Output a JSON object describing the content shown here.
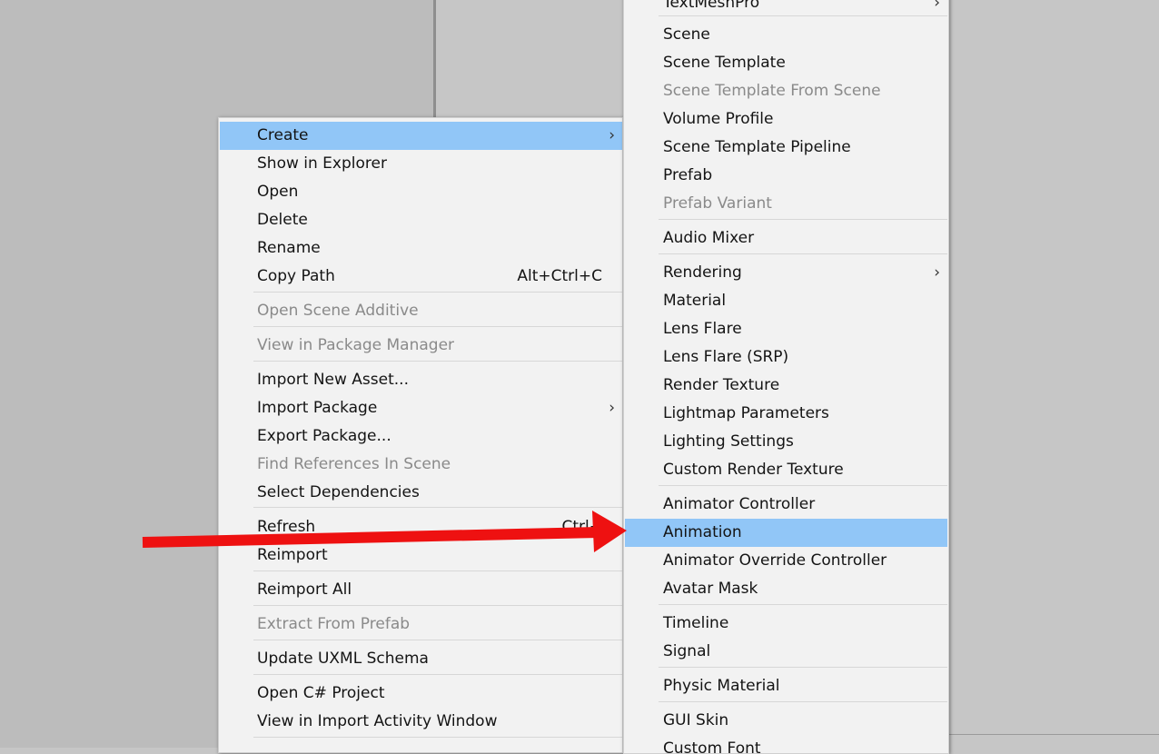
{
  "context_menu": {
    "items": [
      {
        "label": "Create",
        "shortcut": "",
        "submenu": true,
        "disabled": false,
        "highlighted": true
      },
      {
        "label": "Show in Explorer",
        "shortcut": "",
        "submenu": false,
        "disabled": false,
        "highlighted": false
      },
      {
        "label": "Open",
        "shortcut": "",
        "submenu": false,
        "disabled": false,
        "highlighted": false
      },
      {
        "label": "Delete",
        "shortcut": "",
        "submenu": false,
        "disabled": false,
        "highlighted": false
      },
      {
        "label": "Rename",
        "shortcut": "",
        "submenu": false,
        "disabled": false,
        "highlighted": false
      },
      {
        "label": "Copy Path",
        "shortcut": "Alt+Ctrl+C",
        "submenu": false,
        "disabled": false,
        "highlighted": false
      },
      {
        "label": "Open Scene Additive",
        "shortcut": "",
        "submenu": false,
        "disabled": true,
        "highlighted": false
      },
      {
        "label": "View in Package Manager",
        "shortcut": "",
        "submenu": false,
        "disabled": true,
        "highlighted": false
      },
      {
        "label": "Import New Asset...",
        "shortcut": "",
        "submenu": false,
        "disabled": false,
        "highlighted": false
      },
      {
        "label": "Import Package",
        "shortcut": "",
        "submenu": true,
        "disabled": false,
        "highlighted": false
      },
      {
        "label": "Export Package...",
        "shortcut": "",
        "submenu": false,
        "disabled": false,
        "highlighted": false
      },
      {
        "label": "Find References In Scene",
        "shortcut": "",
        "submenu": false,
        "disabled": true,
        "highlighted": false
      },
      {
        "label": "Select Dependencies",
        "shortcut": "",
        "submenu": false,
        "disabled": false,
        "highlighted": false
      },
      {
        "label": "Refresh",
        "shortcut": "Ctrl+",
        "submenu": false,
        "disabled": false,
        "highlighted": false
      },
      {
        "label": "Reimport",
        "shortcut": "",
        "submenu": false,
        "disabled": false,
        "highlighted": false
      },
      {
        "label": "Reimport All",
        "shortcut": "",
        "submenu": false,
        "disabled": false,
        "highlighted": false
      },
      {
        "label": "Extract From Prefab",
        "shortcut": "",
        "submenu": false,
        "disabled": true,
        "highlighted": false
      },
      {
        "label": "Update UXML Schema",
        "shortcut": "",
        "submenu": false,
        "disabled": false,
        "highlighted": false
      },
      {
        "label": "Open C# Project",
        "shortcut": "",
        "submenu": false,
        "disabled": false,
        "highlighted": false
      },
      {
        "label": "View in Import Activity Window",
        "shortcut": "",
        "submenu": false,
        "disabled": false,
        "highlighted": false
      }
    ]
  },
  "create_submenu": {
    "items": [
      {
        "label": "TextMeshPro",
        "submenu": true,
        "disabled": false,
        "highlighted": false
      },
      {
        "label": "Scene",
        "submenu": false,
        "disabled": false,
        "highlighted": false
      },
      {
        "label": "Scene Template",
        "submenu": false,
        "disabled": false,
        "highlighted": false
      },
      {
        "label": "Scene Template From Scene",
        "submenu": false,
        "disabled": true,
        "highlighted": false
      },
      {
        "label": "Volume Profile",
        "submenu": false,
        "disabled": false,
        "highlighted": false
      },
      {
        "label": "Scene Template Pipeline",
        "submenu": false,
        "disabled": false,
        "highlighted": false
      },
      {
        "label": "Prefab",
        "submenu": false,
        "disabled": false,
        "highlighted": false
      },
      {
        "label": "Prefab Variant",
        "submenu": false,
        "disabled": true,
        "highlighted": false
      },
      {
        "label": "Audio Mixer",
        "submenu": false,
        "disabled": false,
        "highlighted": false
      },
      {
        "label": "Rendering",
        "submenu": true,
        "disabled": false,
        "highlighted": false
      },
      {
        "label": "Material",
        "submenu": false,
        "disabled": false,
        "highlighted": false
      },
      {
        "label": "Lens Flare",
        "submenu": false,
        "disabled": false,
        "highlighted": false
      },
      {
        "label": "Lens Flare (SRP)",
        "submenu": false,
        "disabled": false,
        "highlighted": false
      },
      {
        "label": "Render Texture",
        "submenu": false,
        "disabled": false,
        "highlighted": false
      },
      {
        "label": "Lightmap Parameters",
        "submenu": false,
        "disabled": false,
        "highlighted": false
      },
      {
        "label": "Lighting Settings",
        "submenu": false,
        "disabled": false,
        "highlighted": false
      },
      {
        "label": "Custom Render Texture",
        "submenu": false,
        "disabled": false,
        "highlighted": false
      },
      {
        "label": "Animator Controller",
        "submenu": false,
        "disabled": false,
        "highlighted": false
      },
      {
        "label": "Animation",
        "submenu": false,
        "disabled": false,
        "highlighted": true
      },
      {
        "label": "Animator Override Controller",
        "submenu": false,
        "disabled": false,
        "highlighted": false
      },
      {
        "label": "Avatar Mask",
        "submenu": false,
        "disabled": false,
        "highlighted": false
      },
      {
        "label": "Timeline",
        "submenu": false,
        "disabled": false,
        "highlighted": false
      },
      {
        "label": "Signal",
        "submenu": false,
        "disabled": false,
        "highlighted": false
      },
      {
        "label": "Physic Material",
        "submenu": false,
        "disabled": false,
        "highlighted": false
      },
      {
        "label": "GUI Skin",
        "submenu": false,
        "disabled": false,
        "highlighted": false
      },
      {
        "label": "Custom Font",
        "submenu": false,
        "disabled": false,
        "highlighted": false
      }
    ]
  },
  "annotation": {
    "arrow_color": "#ee1111"
  },
  "colors": {
    "highlight": "#91c6f7",
    "menu_bg": "#f2f2f2",
    "disabled_text": "#8a8a8a"
  }
}
